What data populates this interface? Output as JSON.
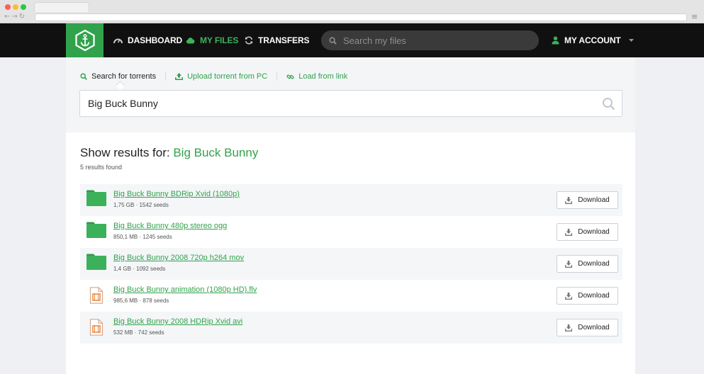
{
  "header": {
    "nav": [
      {
        "label": "DASHBOARD",
        "icon": "dashboard-icon"
      },
      {
        "label": "MY FILES",
        "icon": "cloud-icon",
        "active": true
      },
      {
        "label": "TRANSFERS",
        "icon": "refresh-icon"
      }
    ],
    "search_placeholder": "Search my files",
    "account_label": "MY ACCOUNT"
  },
  "panel": {
    "tabs": [
      {
        "label": "Search for torrents",
        "icon": "search-icon",
        "active": true
      },
      {
        "label": "Upload torrent from PC",
        "icon": "upload-icon"
      },
      {
        "label": "Load from link",
        "icon": "link-icon"
      }
    ],
    "search_value": "Big Buck Bunny",
    "results_prefix": "Show results for: ",
    "results_query": "Big Buck Bunny",
    "results_count": "5 results found",
    "download_label": "Download",
    "results": [
      {
        "name": "Big Buck Bunny BDRip Xvid (1080p)",
        "meta": "1,75 GB · 1542 seeds",
        "type": "folder"
      },
      {
        "name": "Big Buck Bunny 480p stereo ogg",
        "meta": "850,1 MB · 1245 seeds",
        "type": "folder"
      },
      {
        "name": "Big Buck Bunny 2008 720p h264 mov",
        "meta": "1,4 GB · 1092 seeds",
        "type": "folder"
      },
      {
        "name": "Big Buck Bunny animation (1080p HD).flv",
        "meta": "985,6 MB · 878 seeds",
        "type": "video"
      },
      {
        "name": "Big Buck Bunny 2008 HDRip Xvid avi",
        "meta": "532 MB · 742 seeds",
        "type": "video"
      }
    ]
  },
  "colors": {
    "accent": "#31a24c",
    "header_bg": "#101010",
    "video_icon": "#e8843a"
  }
}
